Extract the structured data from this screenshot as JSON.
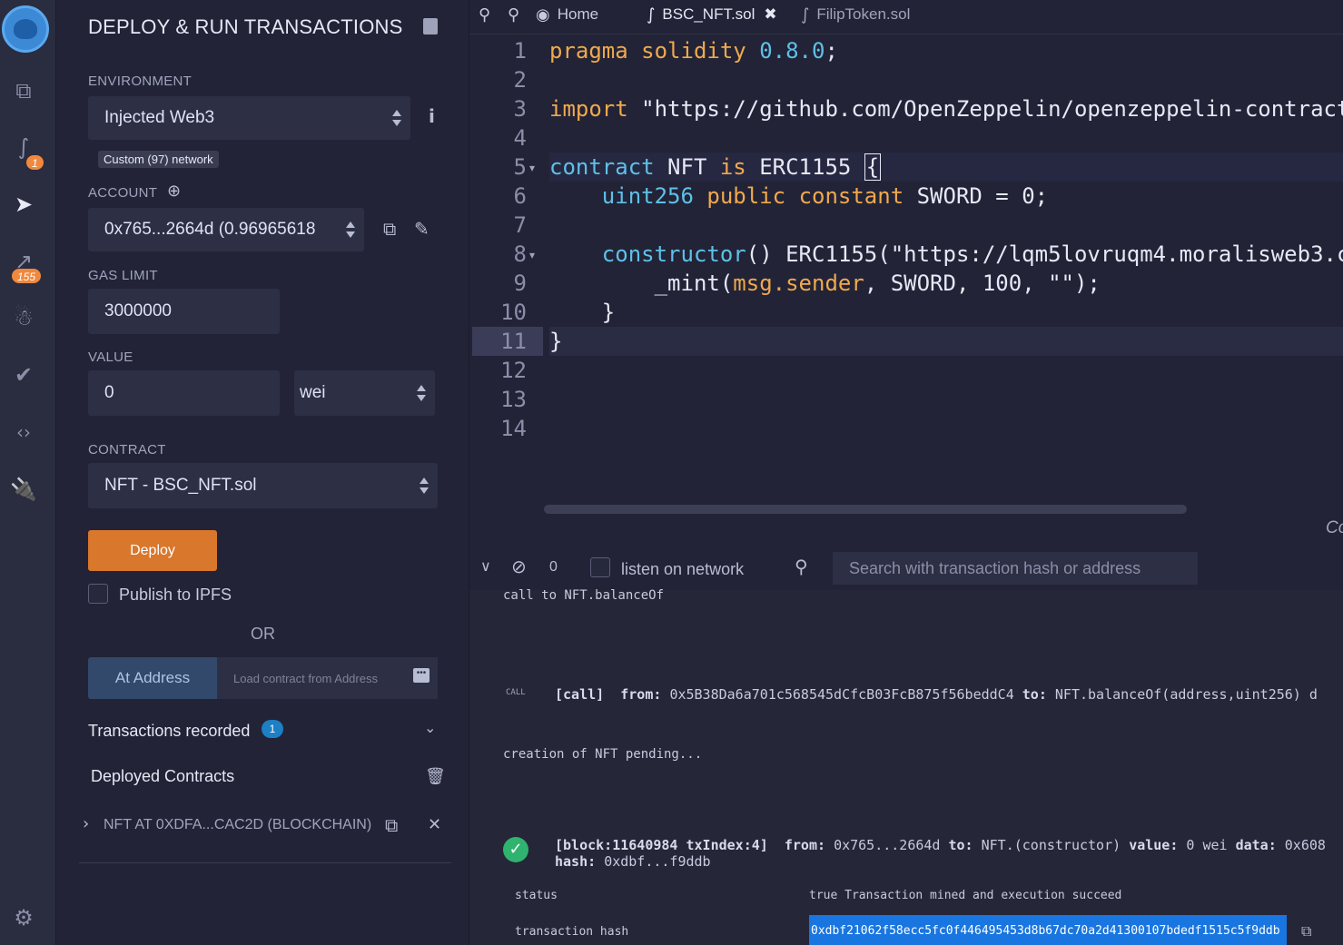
{
  "panel": {
    "title": "DEPLOY & RUN TRANSACTIONS",
    "environment_label": "ENVIRONMENT",
    "environment_value": "Injected Web3",
    "network_badge": "Custom (97) network",
    "account_label": "ACCOUNT",
    "account_value": "0x765...2664d (0.96965618",
    "gas_limit_label": "GAS LIMIT",
    "gas_limit_value": "3000000",
    "value_label": "VALUE",
    "value_amount": "0",
    "value_unit": "wei",
    "contract_label": "CONTRACT",
    "contract_value": "NFT - BSC_NFT.sol",
    "deploy_label": "Deploy",
    "publish_label": "Publish to IPFS",
    "or_label": "OR",
    "at_address_label": "At Address",
    "load_address_placeholder": "Load contract from Address",
    "transactions_label": "Transactions recorded",
    "transactions_count": "1",
    "deployed_label": "Deployed Contracts",
    "deployed_item": "NFT AT 0XDFA...CAC2D (BLOCKCHAIN)"
  },
  "iconbar": {
    "compile_badge": "1",
    "analytics_badge": "155",
    "icons": [
      "remix-logo-icon",
      "file-explorer-icon",
      "solidity-compiler-icon",
      "deploy-run-icon",
      "analytics-icon",
      "debugger-icon",
      "tests-icon",
      "source-verify-icon",
      "plugin-manager-icon",
      "settings-icon"
    ]
  },
  "tabs": {
    "home": "Home",
    "active_file": "BSC_NFT.sol",
    "other_file": "FilipToken.sol"
  },
  "editor": {
    "line_numbers": [
      "1",
      "2",
      "3",
      "4",
      "5",
      "6",
      "7",
      "8",
      "9",
      "10",
      "11",
      "12",
      "13",
      "14"
    ],
    "clipped_text": "Co"
  },
  "terminal": {
    "tx_count": "0",
    "listen_label": "listen on network",
    "search_placeholder": "Search with transaction hash or address",
    "call_line": "call to NFT.balanceOf",
    "call_tag": "CALL",
    "call_detail_prefix": "[call]",
    "call_from_label": "from:",
    "call_from": "0x5B38Da6a701c568545dCfcB03FcB875f56beddC4",
    "call_to_label": "to:",
    "call_to": "NFT.balanceOf(address,uint256) d",
    "creation_line": "creation of NFT pending...",
    "block_info": "[block:11640984 txIndex:4]",
    "tx_from_label": "from:",
    "tx_from": "0x765...2664d",
    "tx_to_label": "to:",
    "tx_to": "NFT.(constructor)",
    "tx_value_label": "value:",
    "tx_value": "0 wei",
    "tx_data_label": "data:",
    "tx_data": "0x608",
    "hash_label": "hash:",
    "hash_short": "0xdbf...f9ddb",
    "status_label": "status",
    "status_value": "true Transaction mined and execution succeed",
    "txhash_label": "transaction hash",
    "txhash_value": "0xdbf21062f58ecc5fc0f446495453d8b67dc70a2d41300107bdedf1515c5f9ddb"
  }
}
